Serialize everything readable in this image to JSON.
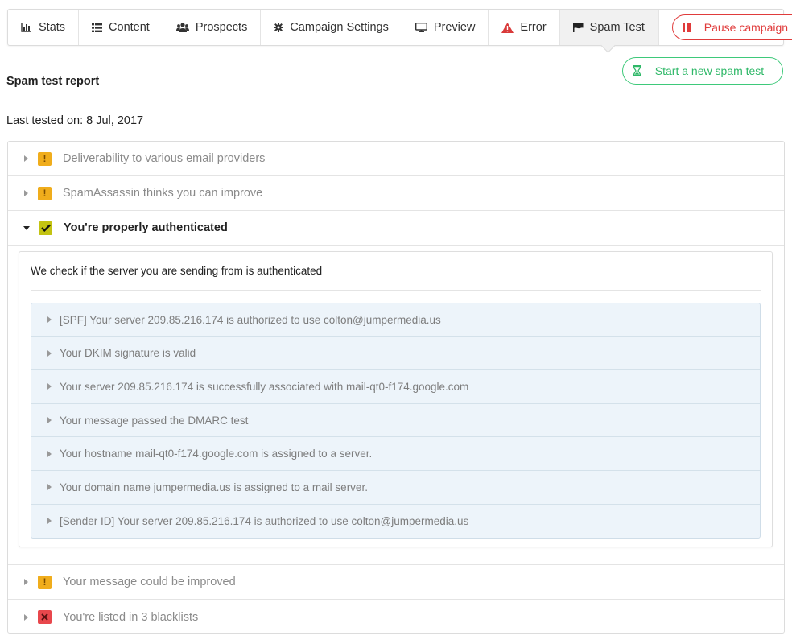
{
  "nav": {
    "tabs": [
      {
        "label": "Stats",
        "icon": "bar-chart-icon"
      },
      {
        "label": "Content",
        "icon": "list-icon"
      },
      {
        "label": "Prospects",
        "icon": "users-icon"
      },
      {
        "label": "Campaign Settings",
        "icon": "gear-icon"
      },
      {
        "label": "Preview",
        "icon": "monitor-icon"
      },
      {
        "label": "Error",
        "icon": "warning-icon"
      },
      {
        "label": "Spam Test",
        "icon": "flag-icon",
        "active": true
      }
    ],
    "pause_label": "Pause campaign"
  },
  "header": {
    "title": "Spam test report",
    "new_spam_test_label": "Start a new spam test",
    "last_tested": "Last tested on: 8 Jul, 2017"
  },
  "accordion": {
    "items": [
      {
        "label": "Deliverability to various email providers",
        "status": "warning"
      },
      {
        "label": "SpamAssassin thinks you can improve",
        "status": "warning"
      },
      {
        "label": "You're properly authenticated",
        "status": "ok",
        "expanded": true
      },
      {
        "label": "Your message could be improved",
        "status": "warning"
      },
      {
        "label": "You're listed in 3 blacklists",
        "status": "error"
      }
    ],
    "auth_description": "We check if the server you are sending from is authenticated",
    "auth_checks": [
      "[SPF] Your server 209.85.216.174 is authorized to use colton@jumpermedia.us",
      "Your DKIM signature is valid",
      "Your server 209.85.216.174 is successfully associated with mail-qt0-f174.google.com",
      "Your message passed the DMARC test",
      "Your hostname mail-qt0-f174.google.com is assigned to a server.",
      "Your domain name jumpermedia.us is assigned to a mail server.",
      "[Sender ID] Your server 209.85.216.174 is authorized to use colton@jumpermedia.us"
    ]
  },
  "colors": {
    "danger": "#e03b3b",
    "success": "#3ec97a",
    "warning": "#f0ad1c",
    "ok": "#c3c312",
    "error": "#e8474c",
    "check_bg": "#edf4fa"
  }
}
